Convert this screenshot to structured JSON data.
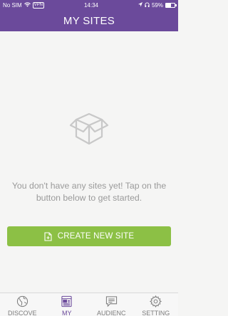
{
  "status_bar": {
    "carrier": "No SIM",
    "time": "14:34",
    "battery_text": "59%",
    "battery_level": 0.59
  },
  "header": {
    "title": "MY SITES"
  },
  "empty_state": {
    "icon": "open-box-icon",
    "line1": "You don't have any sites yet! Tap on the",
    "line2": "button below to get started."
  },
  "create_button": {
    "label": "CREATE NEW SITE",
    "icon": "new-document-icon"
  },
  "tabs": [
    {
      "label": "DISCOVE",
      "icon": "globe-icon"
    },
    {
      "label": "MY",
      "icon": "sites-icon"
    },
    {
      "label": "AUDIENC",
      "icon": "chat-icon"
    },
    {
      "label": "SETTING",
      "icon": "gear-icon"
    }
  ],
  "colors": {
    "brand": "#6b4a9b",
    "accent": "#8cc045",
    "background": "#f5f5f4",
    "muted_text": "#9a9a9a"
  }
}
